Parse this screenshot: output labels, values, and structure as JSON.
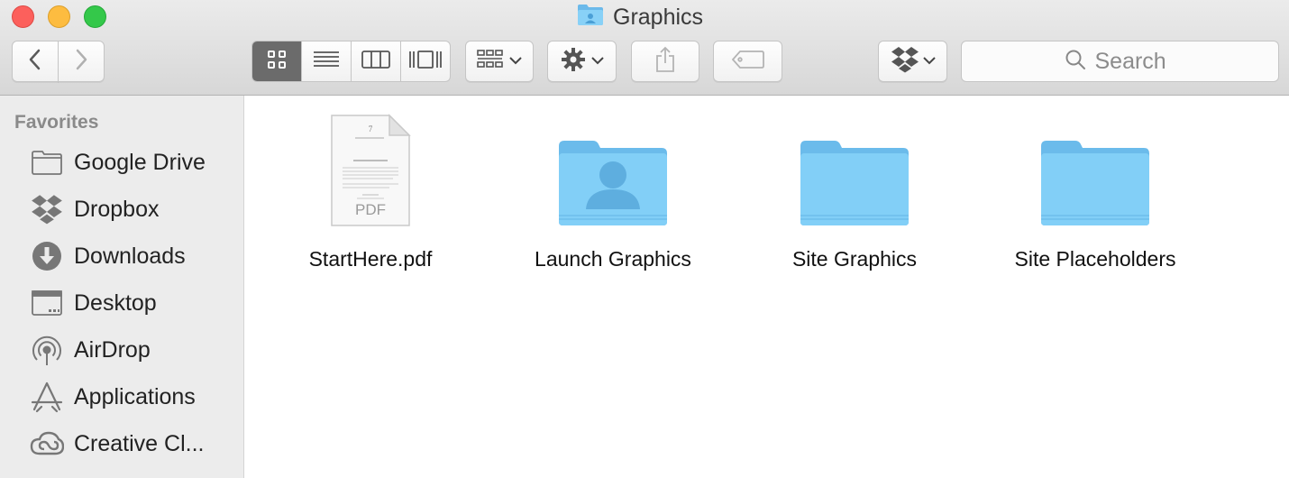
{
  "window": {
    "title": "Graphics"
  },
  "toolbar": {
    "view_modes": [
      {
        "name": "icon-view",
        "active": true
      },
      {
        "name": "list-view",
        "active": false
      },
      {
        "name": "column-view",
        "active": false
      },
      {
        "name": "cover-flow-view",
        "active": false
      }
    ],
    "search_placeholder": "Search",
    "icons": [
      "back-arrow-icon",
      "forward-arrow-icon",
      "group-icon",
      "gear-icon",
      "share-icon",
      "tag-icon",
      "dropbox-icon",
      "search-icon"
    ]
  },
  "sidebar": {
    "heading": "Favorites",
    "items": [
      {
        "label": "Google Drive",
        "icon": "folder-icon"
      },
      {
        "label": "Dropbox",
        "icon": "dropbox-icon"
      },
      {
        "label": "Downloads",
        "icon": "downloads-icon"
      },
      {
        "label": "Desktop",
        "icon": "desktop-icon"
      },
      {
        "label": "AirDrop",
        "icon": "airdrop-icon"
      },
      {
        "label": "Applications",
        "icon": "applications-icon"
      },
      {
        "label": "Creative Cl...",
        "icon": "creative-cloud-icon"
      }
    ]
  },
  "files": [
    {
      "name": "StartHere.pdf",
      "kind": "pdf",
      "thumb_badge": "PDF",
      "thumb_heading": "Getting Started"
    },
    {
      "name": "Launch Graphics",
      "kind": "shared-folder"
    },
    {
      "name": "Site Graphics",
      "kind": "folder"
    },
    {
      "name": "Site Placeholders",
      "kind": "folder"
    }
  ],
  "colors": {
    "close": "#fc605c",
    "minimize": "#fdbc40",
    "maximize": "#34c84a",
    "folder": "#7fcdf5",
    "folder_tab": "#6bb9ea",
    "sidebar_bg": "#ececec",
    "toolbar_bg": "#dcdcdc"
  }
}
